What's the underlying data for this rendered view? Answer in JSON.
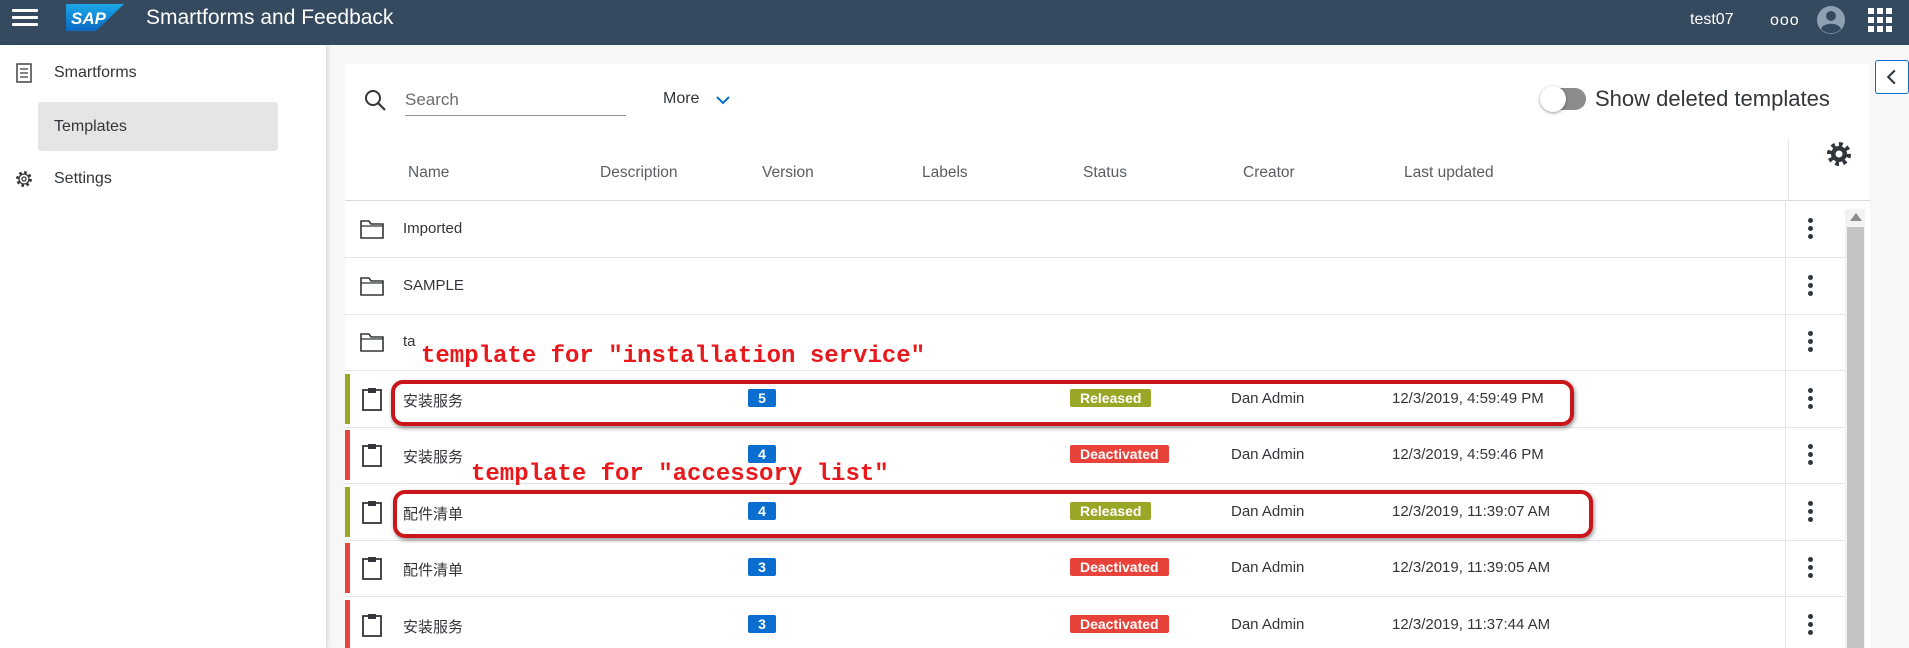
{
  "shell": {
    "title": "Smartforms and Feedback",
    "logo_text": "SAP",
    "user": "test07",
    "overflow": "ooo"
  },
  "sidebar": {
    "items": [
      {
        "label": "Smartforms",
        "icon": "document-icon"
      },
      {
        "label": "Templates"
      },
      {
        "label": "Settings",
        "icon": "gear-icon"
      }
    ]
  },
  "toolbar": {
    "search_placeholder": "Search",
    "more_label": "More",
    "toggle_label": "Show deleted templates",
    "toggle_on": false
  },
  "table": {
    "columns": [
      "Name",
      "Description",
      "Version",
      "Labels",
      "Status",
      "Creator",
      "Last updated"
    ],
    "rows": [
      {
        "type": "folder",
        "name": "Imported"
      },
      {
        "type": "folder",
        "name": "SAMPLE"
      },
      {
        "type": "folder",
        "name": "ta"
      },
      {
        "type": "template",
        "name": "安装服务",
        "version": "5",
        "status": "Released",
        "creator": "Dan Admin",
        "updated": "12/3/2019, 4:59:49 PM"
      },
      {
        "type": "template",
        "name": "安装服务",
        "version": "4",
        "status": "Deactivated",
        "creator": "Dan Admin",
        "updated": "12/3/2019, 4:59:46 PM"
      },
      {
        "type": "template",
        "name": "配件清单",
        "version": "4",
        "status": "Released",
        "creator": "Dan Admin",
        "updated": "12/3/2019, 11:39:07 AM"
      },
      {
        "type": "template",
        "name": "配件清单",
        "version": "3",
        "status": "Deactivated",
        "creator": "Dan Admin",
        "updated": "12/3/2019, 11:39:05 AM"
      },
      {
        "type": "template",
        "name": "安装服务",
        "version": "3",
        "status": "Deactivated",
        "creator": "Dan Admin",
        "updated": "12/3/2019, 11:37:44 AM"
      }
    ]
  },
  "colors": {
    "shell": "#354a5f",
    "released": "#9aa625",
    "deactivated": "#e8433a",
    "version_badge": "#0a6ed1",
    "annotation": "#e8191c"
  },
  "annotations": {
    "installation": "template for \"installation service\"",
    "accessory": "template for \"accessory list\""
  }
}
